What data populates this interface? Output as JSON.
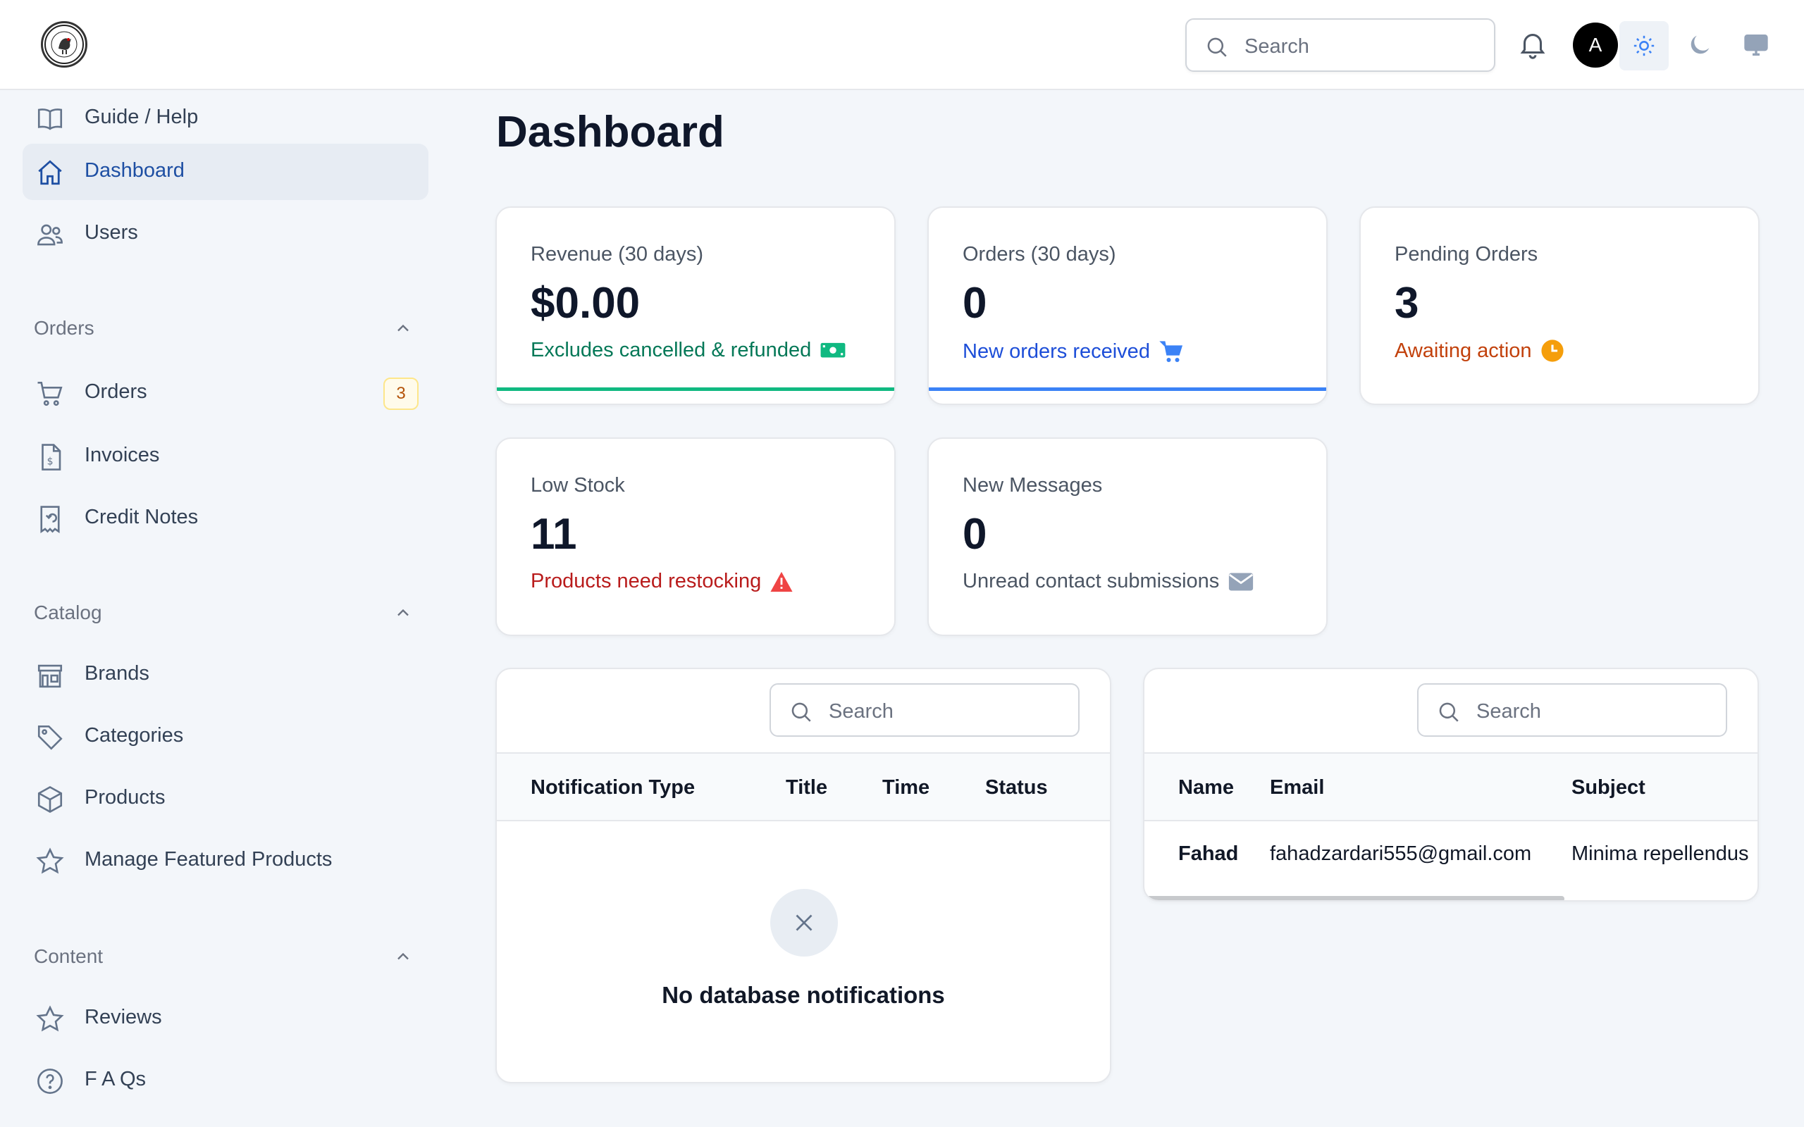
{
  "header": {
    "search_placeholder": "Search",
    "avatar_initial": "A"
  },
  "sidebar": {
    "top_items": [
      {
        "label": "Guide / Help",
        "icon": "book-icon"
      },
      {
        "label": "Dashboard",
        "icon": "home-icon",
        "active": true
      },
      {
        "label": "Users",
        "icon": "users-icon"
      }
    ],
    "groups": [
      {
        "label": "Orders",
        "items": [
          {
            "label": "Orders",
            "icon": "cart-icon",
            "badge": "3"
          },
          {
            "label": "Invoices",
            "icon": "invoice-icon"
          },
          {
            "label": "Credit Notes",
            "icon": "receipt-refund-icon"
          }
        ]
      },
      {
        "label": "Catalog",
        "items": [
          {
            "label": "Brands",
            "icon": "storefront-icon"
          },
          {
            "label": "Categories",
            "icon": "tag-icon"
          },
          {
            "label": "Products",
            "icon": "cube-icon"
          },
          {
            "label": "Manage Featured Products",
            "icon": "star-icon"
          }
        ]
      },
      {
        "label": "Content",
        "items": [
          {
            "label": "Reviews",
            "icon": "star-icon"
          },
          {
            "label": "F A Qs",
            "icon": "question-circle-icon"
          }
        ]
      }
    ]
  },
  "main": {
    "title": "Dashboard",
    "stats": [
      {
        "label": "Revenue (30 days)",
        "value": "$0.00",
        "desc": "Excludes cancelled & refunded",
        "color": "#047857",
        "bar": "#10b981",
        "icon": "cash-icon"
      },
      {
        "label": "Orders (30 days)",
        "value": "0",
        "desc": "New orders received",
        "color": "#1d4ed8",
        "bar": "#3b82f6",
        "icon": "cart-icon"
      },
      {
        "label": "Pending Orders",
        "value": "3",
        "desc": "Awaiting action",
        "color": "#c2410c",
        "icon": "clock-icon"
      },
      {
        "label": "Low Stock",
        "value": "11",
        "desc": "Products need restocking",
        "color": "#b91c1c",
        "icon": "warning-icon"
      },
      {
        "label": "New Messages",
        "value": "0",
        "desc": "Unread contact submissions",
        "color": "#4b5563",
        "icon": "envelope-icon"
      }
    ],
    "notifications_table": {
      "search_placeholder": "Search",
      "columns": [
        "Notification Type",
        "Title",
        "Time",
        "Status"
      ],
      "empty_text": "No database notifications"
    },
    "messages_table": {
      "search_placeholder": "Search",
      "columns": [
        "Name",
        "Email",
        "Subject"
      ],
      "rows": [
        {
          "name": "Fahad",
          "email": "fahadzardari555@gmail.com",
          "subject": "Minima repellendus"
        }
      ]
    }
  }
}
